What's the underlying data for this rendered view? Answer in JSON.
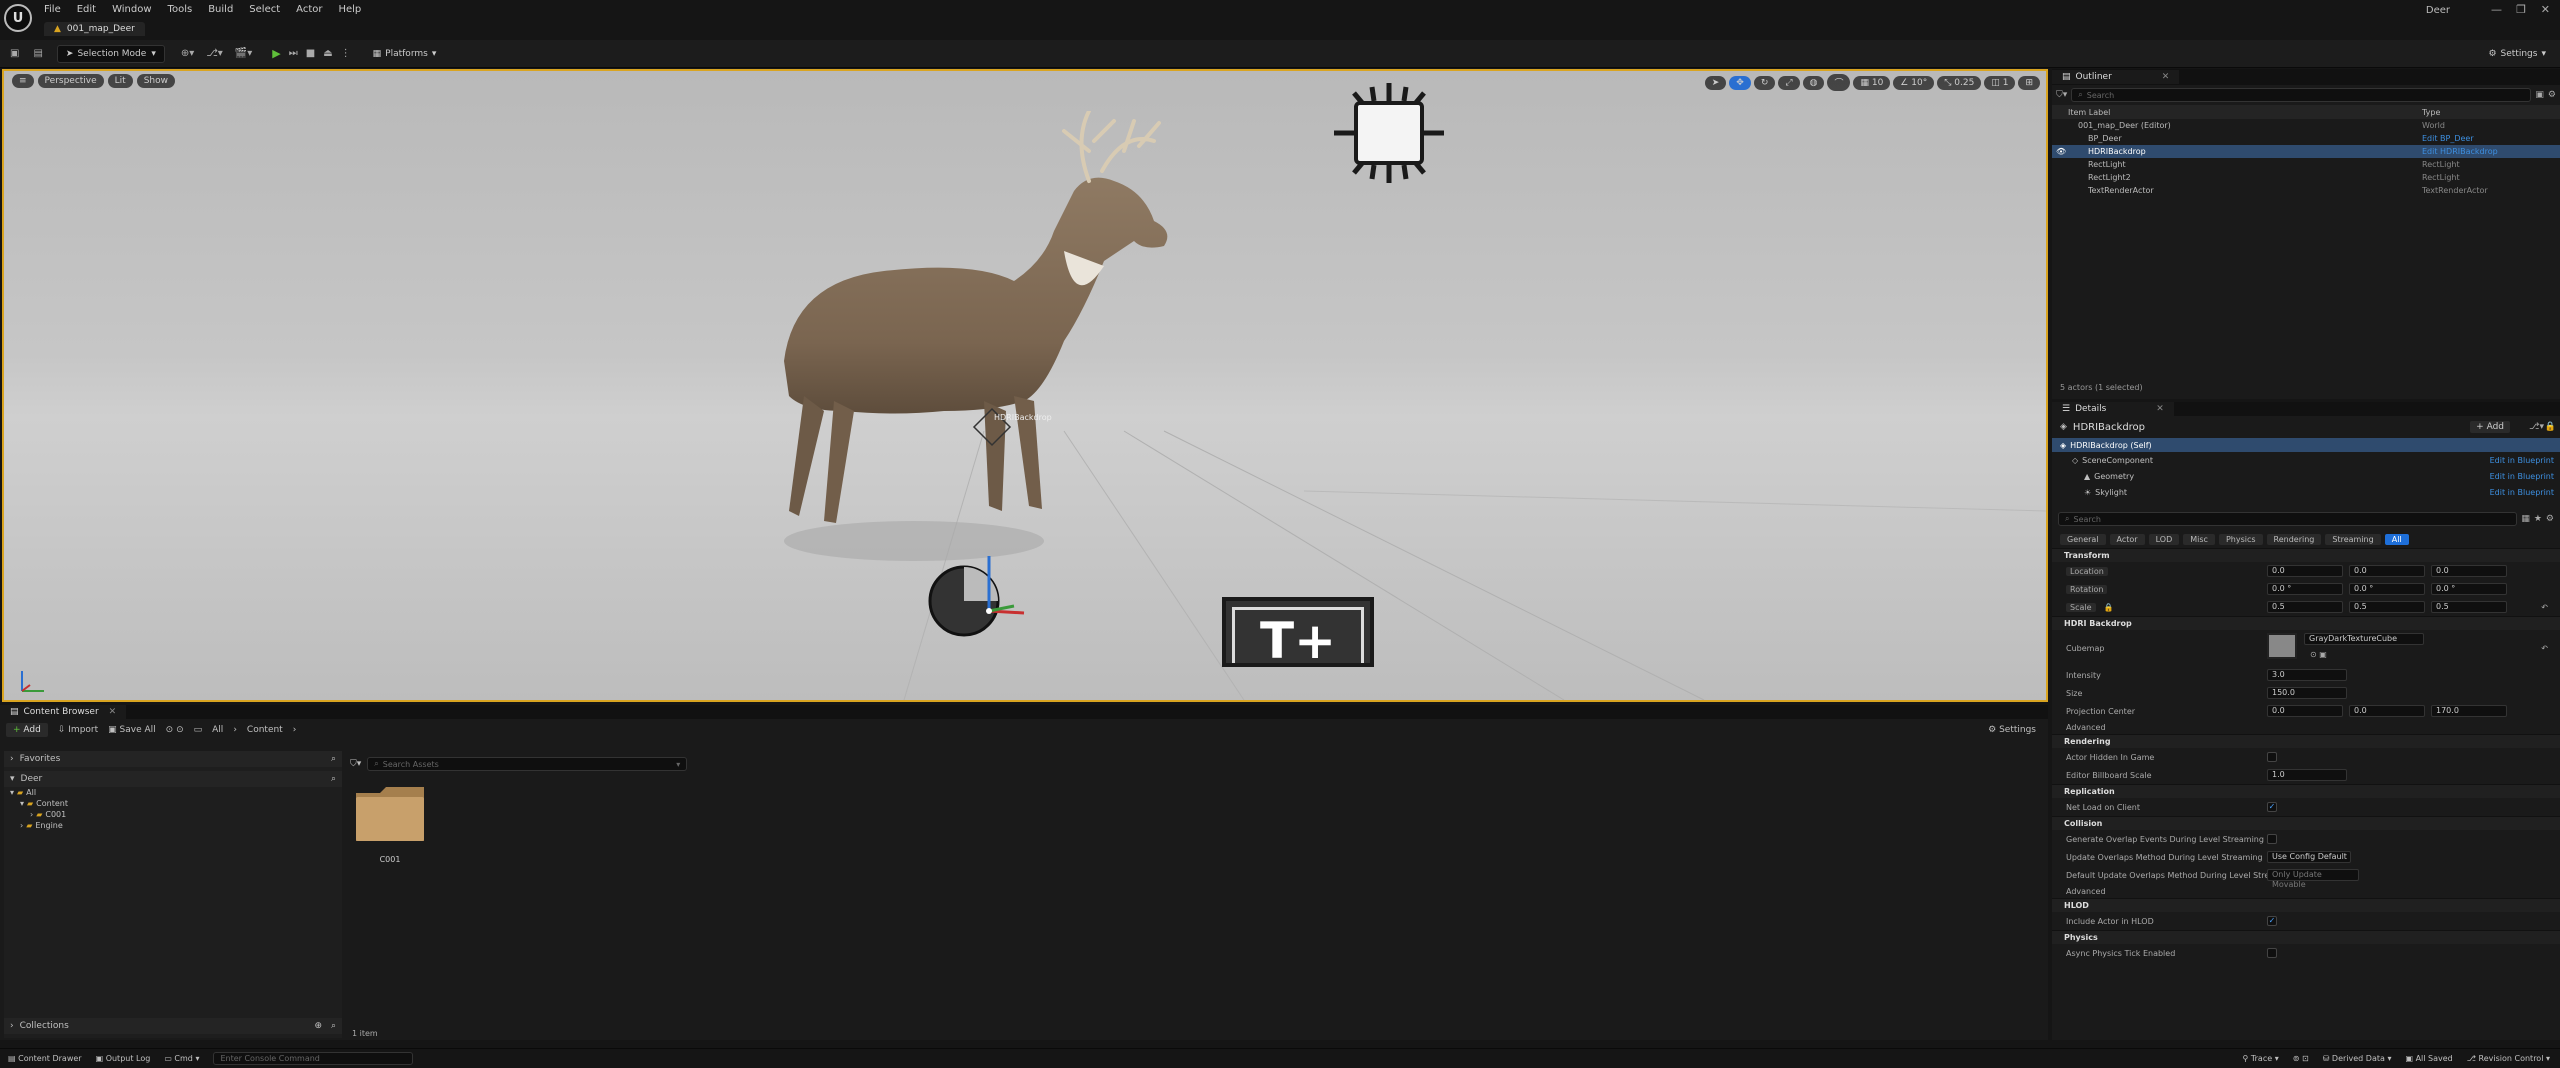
{
  "menubar": {
    "items": [
      "File",
      "Edit",
      "Window",
      "Tools",
      "Build",
      "Select",
      "Actor",
      "Help"
    ],
    "map_tab": "001_map_Deer",
    "window_title": "Deer"
  },
  "toolbar": {
    "selection_mode": "Selection Mode",
    "platforms": "Platforms",
    "settings": "Settings"
  },
  "viewport": {
    "perspective": "Perspective",
    "lit": "Lit",
    "show": "Show",
    "grid_snap": "10",
    "rot_snap": "10°",
    "scale_snap": "0.25",
    "cam_speed": "1",
    "selected_label": "HDRIBackdrop"
  },
  "outliner": {
    "tab": "Outliner",
    "search_placeholder": "Search",
    "col_label": "Item Label",
    "col_type": "Type",
    "rows": [
      {
        "label": "001_map_Deer (Editor)",
        "type": "World"
      },
      {
        "label": "BP_Deer",
        "type": "Edit BP_Deer"
      },
      {
        "label": "HDRIBackdrop",
        "type": "Edit HDRIBackdrop"
      },
      {
        "label": "RectLight",
        "type": "RectLight"
      },
      {
        "label": "RectLight2",
        "type": "RectLight"
      },
      {
        "label": "TextRenderActor",
        "type": "TextRenderActor"
      }
    ],
    "footer": "5 actors (1 selected)"
  },
  "details": {
    "tab": "Details",
    "actor": "HDRIBackdrop",
    "add": "+ Add",
    "components": [
      {
        "label": "HDRIBackdrop (Self)",
        "link": ""
      },
      {
        "label": "SceneComponent",
        "link": "Edit in Blueprint"
      },
      {
        "label": "Geometry",
        "link": "Edit in Blueprint"
      },
      {
        "label": "Skylight",
        "link": "Edit in Blueprint"
      }
    ],
    "search_placeholder": "Search",
    "filters": [
      "General",
      "Actor",
      "LOD",
      "Misc",
      "Physics",
      "Rendering",
      "Streaming",
      "All"
    ],
    "transform": {
      "title": "Transform",
      "location": "Location",
      "rotation": "Rotation",
      "scale": "Scale",
      "loc": [
        "0.0",
        "0.0",
        "0.0"
      ],
      "rot": [
        "0.0 °",
        "0.0 °",
        "0.0 °"
      ],
      "scl": [
        "0.5",
        "0.5",
        "0.5"
      ]
    },
    "hdri": {
      "title": "HDRI Backdrop",
      "cubemap": "Cubemap",
      "cubemap_value": "GrayDarkTextureCube",
      "intensity": "Intensity",
      "intensity_value": "3.0",
      "size": "Size",
      "size_value": "150.0",
      "projection": "Projection Center",
      "proj": [
        "0.0",
        "0.0",
        "170.0"
      ],
      "advanced": "Advanced"
    },
    "rendering": {
      "title": "Rendering",
      "hidden": "Actor Hidden In Game",
      "billboard": "Editor Billboard Scale",
      "billboard_value": "1.0"
    },
    "replication": {
      "title": "Replication",
      "net": "Net Load on Client"
    },
    "collision": {
      "title": "Collision",
      "gen": "Generate Overlap Events During Level Streaming",
      "upd": "Update Overlaps Method During Level Streaming",
      "upd_value": "Use Config Default",
      "def": "Default Update Overlaps Method During Level Streaming",
      "def_value": "Only Update Movable",
      "advanced": "Advanced"
    },
    "hlod": {
      "title": "HLOD",
      "include": "Include Actor in HLOD"
    },
    "physics": {
      "title": "Physics",
      "async": "Async Physics Tick Enabled"
    }
  },
  "content_browser": {
    "tab": "Content Browser",
    "add": "Add",
    "import": "Import",
    "save_all": "Save All",
    "crumbs": [
      "All",
      "Content"
    ],
    "settings": "Settings",
    "favorites": "Favorites",
    "project": "Deer",
    "tree": [
      "All",
      "Content",
      "C001",
      "Engine"
    ],
    "search_placeholder": "Search Assets",
    "folder": "C001",
    "count": "1 item",
    "collections": "Collections"
  },
  "statusbar": {
    "drawer": "Content Drawer",
    "output": "Output Log",
    "cmd": "Cmd",
    "console_placeholder": "Enter Console Command",
    "trace": "Trace",
    "derived": "Derived Data",
    "saved": "All Saved",
    "revision": "Revision Control"
  }
}
